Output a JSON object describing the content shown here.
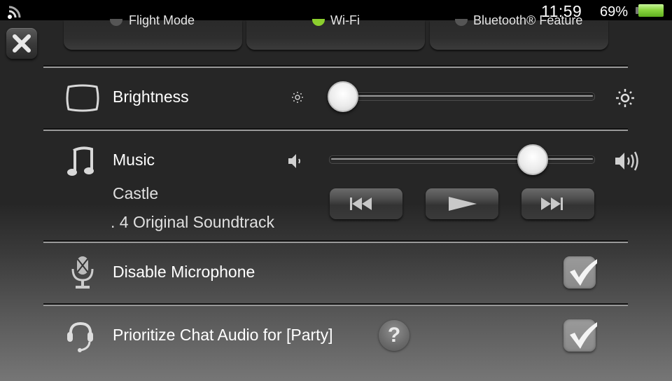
{
  "status_bar": {
    "network_icon": "wifi-signal-icon",
    "time": "11:59",
    "battery_percent": "69%",
    "battery_level": 0.69,
    "battery_icon": "battery-icon"
  },
  "close_button": {
    "icon": "close-x-icon"
  },
  "quick_toggles": [
    {
      "label": "Flight Mode",
      "on": false
    },
    {
      "label": "Wi-Fi",
      "on": true,
      "indicator_color": "#8ccf2e"
    },
    {
      "label": "Bluetooth® Feature",
      "on": false
    }
  ],
  "brightness": {
    "icon": "screen-icon",
    "label": "Brightness",
    "min_icon": "sun-dim-icon",
    "max_icon": "sun-bright-icon",
    "value": 0.0
  },
  "music": {
    "icon": "music-note-icon",
    "label": "Music",
    "track_title": "Castle",
    "album": ". 4 Original Soundtrack",
    "volume_min_icon": "speaker-low-icon",
    "volume_max_icon": "speaker-high-icon",
    "volume": 0.81,
    "controls": [
      {
        "name": "previous",
        "icon": "previous-track-icon"
      },
      {
        "name": "play",
        "icon": "play-icon"
      },
      {
        "name": "next",
        "icon": "next-track-icon"
      }
    ]
  },
  "microphone": {
    "icon": "microphone-disabled-icon",
    "label": "Disable Microphone",
    "checked": true
  },
  "chat_audio": {
    "icon": "headset-icon",
    "label": "Prioritize Chat Audio for [Party]",
    "help_label": "?",
    "checked": true
  }
}
